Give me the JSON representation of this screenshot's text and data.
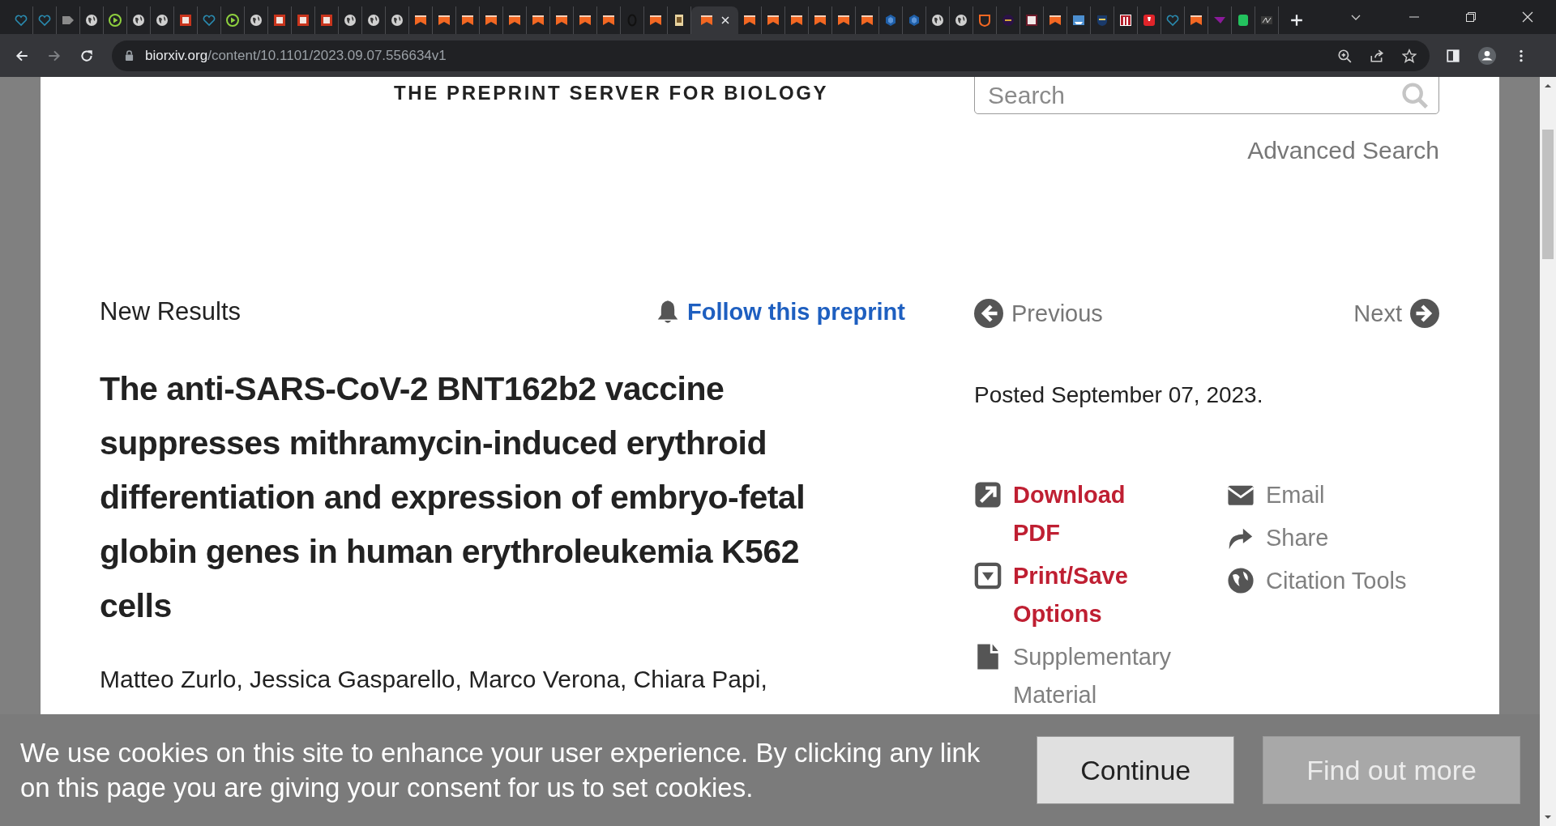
{
  "browser": {
    "tabs": [
      {
        "kind": "heart",
        "selected": false
      },
      {
        "kind": "heart",
        "selected": false
      },
      {
        "kind": "arrow",
        "selected": false
      },
      {
        "kind": "globe",
        "selected": false
      },
      {
        "kind": "play",
        "selected": false
      },
      {
        "kind": "globe",
        "selected": false
      },
      {
        "kind": "globe",
        "selected": false
      },
      {
        "kind": "redsquare",
        "selected": false
      },
      {
        "kind": "heart",
        "selected": false
      },
      {
        "kind": "play",
        "selected": false
      },
      {
        "kind": "globe",
        "selected": false
      },
      {
        "kind": "redsquare",
        "selected": false
      },
      {
        "kind": "redsquare",
        "selected": false
      },
      {
        "kind": "redsquare",
        "selected": false
      },
      {
        "kind": "globe",
        "selected": false
      },
      {
        "kind": "globe",
        "selected": false
      },
      {
        "kind": "globe",
        "selected": false
      },
      {
        "kind": "bookmark",
        "selected": false
      },
      {
        "kind": "bookmark",
        "selected": false
      },
      {
        "kind": "bookmark",
        "selected": false
      },
      {
        "kind": "bookmark",
        "selected": false
      },
      {
        "kind": "bookmark",
        "selected": false
      },
      {
        "kind": "bookmark",
        "selected": false
      },
      {
        "kind": "bookmark",
        "selected": false
      },
      {
        "kind": "bookmark",
        "selected": false
      },
      {
        "kind": "bookmark",
        "selected": false
      },
      {
        "kind": "ring",
        "selected": false
      },
      {
        "kind": "bookmark",
        "selected": false
      },
      {
        "kind": "doc",
        "selected": false
      },
      {
        "kind": "bookmark",
        "selected": true
      },
      {
        "kind": "bookmark",
        "selected": false
      },
      {
        "kind": "bookmark",
        "selected": false
      },
      {
        "kind": "bookmark",
        "selected": false
      },
      {
        "kind": "bookmark",
        "selected": false
      },
      {
        "kind": "bookmark",
        "selected": false
      },
      {
        "kind": "bookmark",
        "selected": false
      },
      {
        "kind": "cube",
        "selected": false
      },
      {
        "kind": "cube",
        "selected": false
      },
      {
        "kind": "globe",
        "selected": false
      },
      {
        "kind": "globe",
        "selected": false
      },
      {
        "kind": "shield",
        "selected": false
      },
      {
        "kind": "purplecircle",
        "selected": false
      },
      {
        "kind": "maroonsquare",
        "selected": false
      },
      {
        "kind": "bookmark",
        "selected": false
      },
      {
        "kind": "ship",
        "selected": false
      },
      {
        "kind": "crest",
        "selected": false
      },
      {
        "kind": "piano",
        "selected": false
      },
      {
        "kind": "torch",
        "selected": false
      },
      {
        "kind": "heart",
        "selected": false
      },
      {
        "kind": "bookmark",
        "selected": false
      },
      {
        "kind": "pennant",
        "selected": false
      },
      {
        "kind": "greensquare",
        "selected": false
      },
      {
        "kind": "greysquare",
        "selected": false
      }
    ],
    "address": {
      "domain": "biorxiv.org",
      "path": "/content/10.1101/2023.09.07.556634v1"
    }
  },
  "header": {
    "tagline": "THE PREPRINT SERVER FOR BIOLOGY",
    "search": {
      "placeholder": "Search"
    },
    "advanced_search": "Advanced Search"
  },
  "article": {
    "section": "New Results",
    "follow": "Follow this preprint",
    "title": "The anti-SARS-CoV-2 BNT162b2 vaccine suppresses mithramycin-induced erythroid differentiation and expression of embryo-fetal globin genes in human erythroleukemia K562 cells",
    "authors": "Matteo Zurlo, Jessica Gasparello, Marco Verona, Chiara Papi,"
  },
  "sidebar": {
    "previous": "Previous",
    "next": "Next",
    "posted": "Posted September 07, 2023.",
    "columns": [
      [
        {
          "label": "Download PDF",
          "kind": "download",
          "primary": true
        },
        {
          "label": "Print/Save Options",
          "kind": "print",
          "primary": true
        },
        {
          "label": "Supplementary Material",
          "kind": "file",
          "primary": false
        }
      ],
      [
        {
          "label": "Email",
          "kind": "email",
          "primary": false
        },
        {
          "label": "Share",
          "kind": "share",
          "primary": false
        },
        {
          "label": "Citation Tools",
          "kind": "globe",
          "primary": false
        }
      ]
    ]
  },
  "cookie_banner": {
    "message": "We use cookies on this site to enhance your user experience. By clicking any link on this page you are giving your consent for us to set cookies.",
    "buttons": [
      {
        "label": "Continue",
        "kind": "primary"
      },
      {
        "label": "Find out more",
        "kind": "secondary"
      }
    ]
  }
}
